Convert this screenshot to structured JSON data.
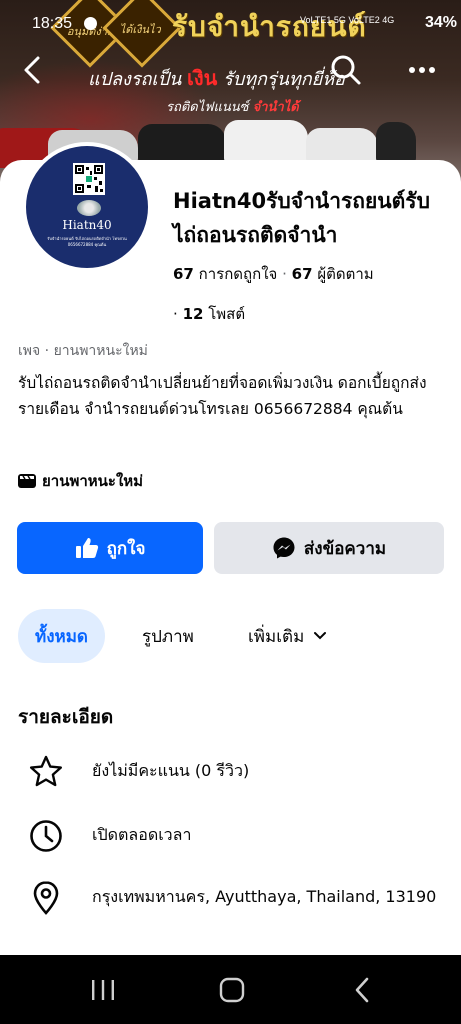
{
  "status_bar": {
    "time": "18:35",
    "signal": "VoLTE1 5G  VoLTE2 4G",
    "battery": "34%"
  },
  "cover": {
    "headline": "รับจำนำรถยนต์",
    "badge_left": "อนุมัติง่าย",
    "badge_right": "ได้เงินไว",
    "sub_pre": "แปลงรถเป็น",
    "sub_accent": "เงิน",
    "sub_post": "รับทุกรุ่นทุกยี่ห้อ",
    "sub2_pre": "รถติดไฟแนนซ์",
    "sub2_accent": "จำนำได้"
  },
  "profile": {
    "avatar_name": "Hiatn40",
    "avatar_tiny": "รับจำนำรถยนต์ รับไถ่ถอนรถติดจำนำ โทรด่วน 0656672884 คุณต้น",
    "title": "Hiatn40รับจำนำรถยนต์รับไถ่ถอนรถติดจำนำ",
    "likes_count": "67",
    "likes_label": "การกดถูกใจ",
    "sep": "·",
    "followers_count": "67",
    "followers_label": "ผู้ติดตาม",
    "posts_count": "12",
    "posts_label": "โพสต์"
  },
  "about": {
    "category_line": "เพจ · ยานพาหนะใหม่",
    "bio": "รับไถ่ถอนรถติดจำนำเปลี่ยนย้ายที่จอดเพิ่มวงเงิน ดอกเบี้ยถูกส่งรายเดือน จำนำรถยนต์ด่วนโทรเลย 0656672884 คุณต้น",
    "category": "ยานพาหนะใหม่"
  },
  "buttons": {
    "like": "ถูกใจ",
    "message": "ส่งข้อความ"
  },
  "tabs": {
    "all": "ทั้งหมด",
    "photos": "รูปภาพ",
    "more": "เพิ่มเติม"
  },
  "details": {
    "title": "รายละเอียด",
    "rating": "ยังไม่มีคะแนน (0 รีวิว)",
    "hours": "เปิดตลอดเวลา",
    "address": "กรุงเทพมหานคร, Ayutthaya, Thailand, 13190"
  },
  "colors": {
    "primary": "#0866ff",
    "secondary_button": "#e4e6eb",
    "active_tab_bg": "#e0edff",
    "avatar_bg": "#1a2d6d"
  },
  "icons": {
    "back": "back-arrow-icon",
    "search": "search-icon",
    "more": "more-dots-icon",
    "like": "thumbs-up-icon",
    "messenger": "messenger-icon",
    "star": "star-icon",
    "clock": "clock-icon",
    "pin": "location-pin-icon"
  }
}
